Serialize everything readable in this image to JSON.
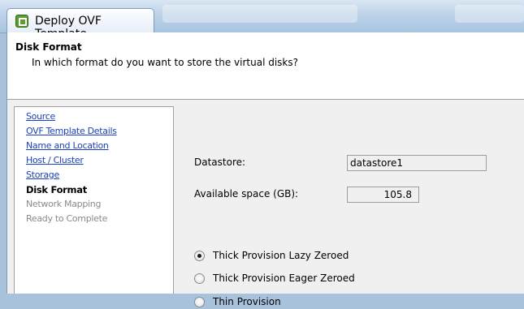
{
  "window": {
    "title": "Deploy OVF Template",
    "icon": "ovf-deploy-icon"
  },
  "header": {
    "title": "Disk Format",
    "subtitle": "In which format do you want to store the virtual disks?"
  },
  "nav": {
    "items": [
      {
        "label": "Source",
        "state": "link"
      },
      {
        "label": "OVF Template Details",
        "state": "link"
      },
      {
        "label": "Name and Location",
        "state": "link"
      },
      {
        "label": "Host / Cluster",
        "state": "link"
      },
      {
        "label": "Storage",
        "state": "link"
      },
      {
        "label": "Disk Format",
        "state": "current"
      },
      {
        "label": "Network Mapping",
        "state": "disabled"
      },
      {
        "label": "Ready to Complete",
        "state": "disabled"
      }
    ]
  },
  "form": {
    "datastore_label": "Datastore:",
    "datastore_value": "datastore1",
    "space_label": "Available space (GB):",
    "space_value": "105.8",
    "options": [
      {
        "label": "Thick Provision Lazy Zeroed",
        "checked": true
      },
      {
        "label": "Thick Provision Eager Zeroed",
        "checked": false
      },
      {
        "label": "Thin Provision",
        "checked": false
      }
    ]
  },
  "colors": {
    "link": "#1a3fc0",
    "disabled": "#8a8a8a",
    "chrome": "#a9c4e0"
  }
}
